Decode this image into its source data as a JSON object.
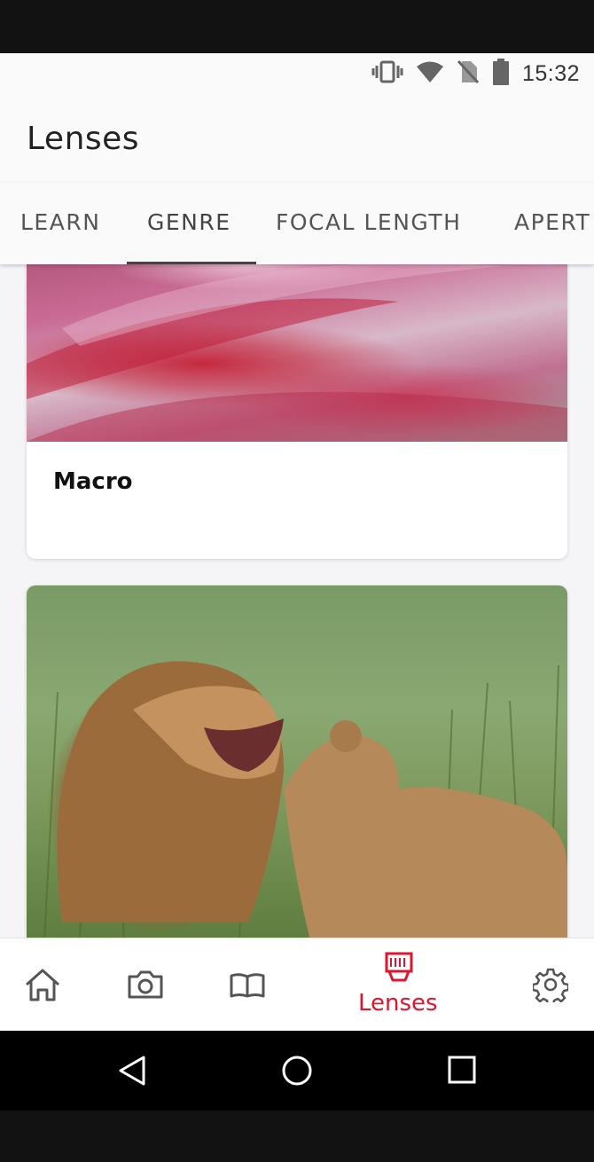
{
  "status_bar": {
    "time": "15:32"
  },
  "app": {
    "title": "Lenses"
  },
  "tabs": [
    {
      "label": "LEARN"
    },
    {
      "label": "GENRE"
    },
    {
      "label": "FOCAL LENGTH"
    },
    {
      "label": "APERT"
    }
  ],
  "selected_tab": "GENRE",
  "cards": [
    {
      "label": "Macro",
      "image": "macro-flower"
    },
    {
      "label": "",
      "image": "lions"
    }
  ],
  "bottom_nav": {
    "items": [
      "home-icon",
      "camera-icon",
      "book-icon",
      "lens-icon",
      "gear-icon"
    ],
    "active_label": "Lenses"
  },
  "colors": {
    "accent": "#e0142c",
    "background": "#f5f5f8"
  }
}
